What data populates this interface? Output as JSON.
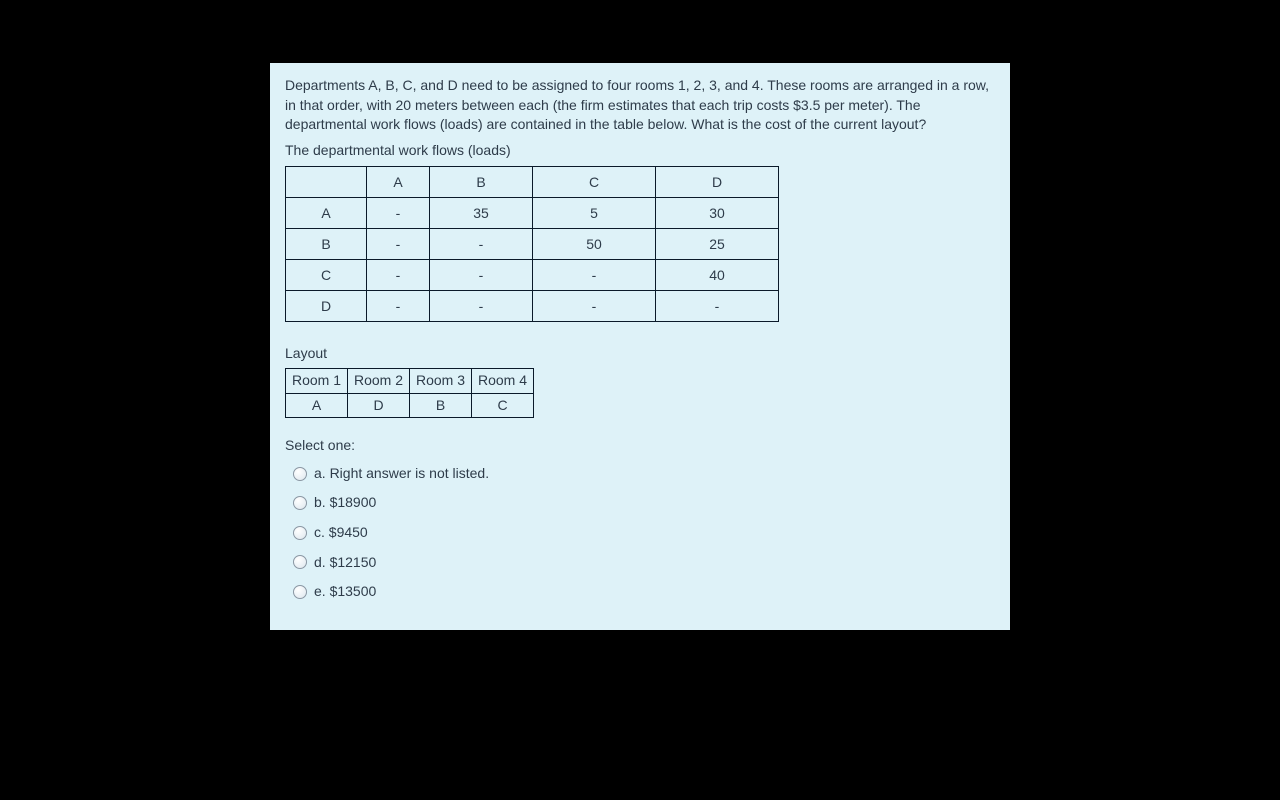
{
  "problem": "Departments A, B, C, and D need to be assigned to four rooms 1, 2, 3, and 4. These rooms are arranged in a row, in that order, with 20 meters between each (the firm estimates that each trip costs $3.5 per meter). The departmental work flows (loads) are contained in the table below. What is the cost of the current layout?",
  "sub_heading": "The departmental work flows (loads)",
  "loads": {
    "cols": [
      "",
      "A",
      "B",
      "C",
      "D"
    ],
    "rows": [
      {
        "head": "A",
        "cells": [
          "-",
          "35",
          "5",
          "30"
        ]
      },
      {
        "head": "B",
        "cells": [
          "-",
          "-",
          "50",
          "25"
        ]
      },
      {
        "head": "C",
        "cells": [
          "-",
          "-",
          "-",
          "40"
        ]
      },
      {
        "head": "D",
        "cells": [
          "-",
          "-",
          "-",
          "-"
        ]
      }
    ]
  },
  "layout_label": "Layout",
  "layout": {
    "rooms": [
      "Room 1",
      "Room 2",
      "Room 3",
      "Room 4"
    ],
    "assign": [
      "A",
      "D",
      "B",
      "C"
    ]
  },
  "select_one": "Select one:",
  "options": [
    "a. Right answer is not listed.",
    "b. $18900",
    "c. $9450",
    "d. $12150",
    "e. $13500"
  ]
}
